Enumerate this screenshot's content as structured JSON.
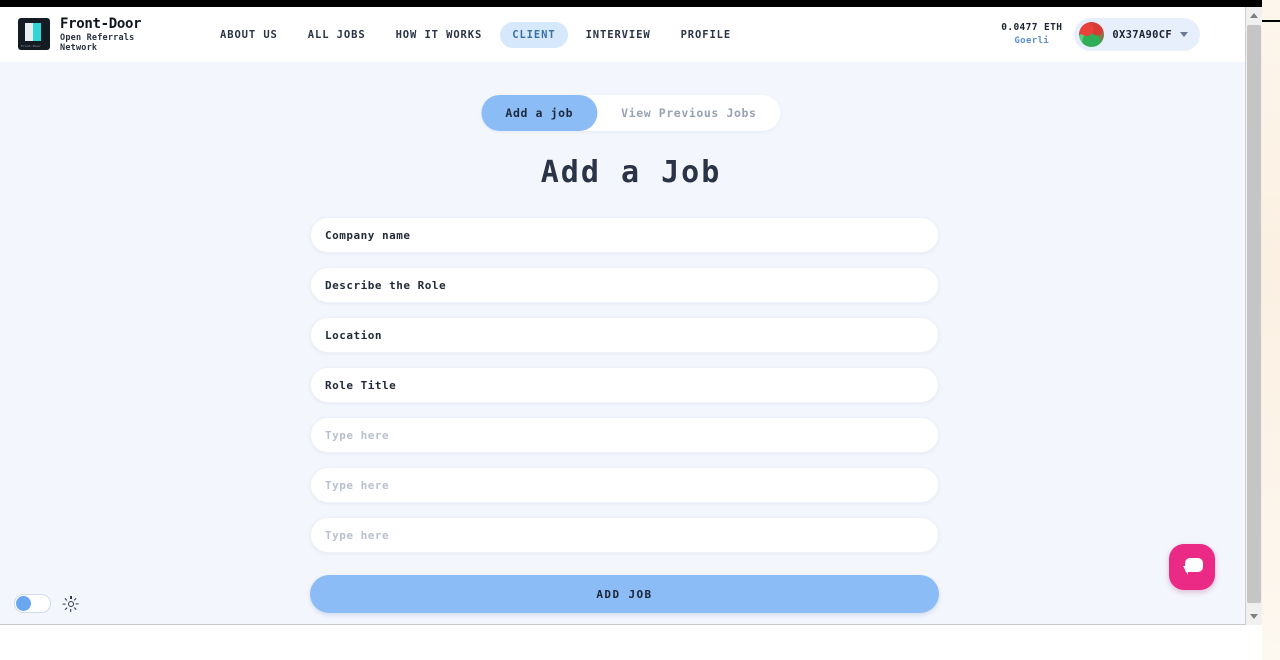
{
  "brand": {
    "name": "Front-Door",
    "tagline": "Open Referrals Network",
    "logo_caption": "Front-Door",
    "logo_icon": "door-logo-icon"
  },
  "nav": {
    "items": [
      {
        "label": "ABOUT US",
        "active": false
      },
      {
        "label": "ALL JOBS",
        "active": false
      },
      {
        "label": "HOW IT WORKS",
        "active": false
      },
      {
        "label": "CLIENT",
        "active": true
      },
      {
        "label": "INTERVIEW",
        "active": false
      },
      {
        "label": "PROFILE",
        "active": false
      }
    ],
    "active_accent": "#d6e8fb"
  },
  "wallet": {
    "balance": "0.0477 ETH",
    "network": "Goerli",
    "address": "0X37A90CF",
    "avatar_icon": "blockies-avatar-icon",
    "chevron_icon": "chevron-down-icon",
    "network_color": "#5a8fd6",
    "pill_color": "#e6effb"
  },
  "tabs": [
    {
      "label": "Add a job",
      "active": true
    },
    {
      "label": "View Previous Jobs",
      "active": false
    }
  ],
  "page": {
    "title": "Add a Job",
    "background": "#f3f6fd"
  },
  "form": {
    "fields": [
      {
        "value": "Company name",
        "placeholder": "Company name",
        "filled": true
      },
      {
        "value": "Describe the Role",
        "placeholder": "Describe the Role",
        "filled": true
      },
      {
        "value": "Location",
        "placeholder": "Location",
        "filled": true
      },
      {
        "value": "Role Title",
        "placeholder": "Role Title",
        "filled": true
      },
      {
        "value": "",
        "placeholder": "Type here",
        "filled": false
      },
      {
        "value": "",
        "placeholder": "Type here",
        "filled": false
      },
      {
        "value": "",
        "placeholder": "Type here",
        "filled": false
      }
    ],
    "submit_label": "ADD JOB",
    "submit_color": "#8cbcf5"
  },
  "theme_toggle": {
    "state": "off",
    "toggle_icon": "theme-toggle-icon",
    "sun_icon": "sun-icon"
  },
  "chat": {
    "icon": "chat-bubble-icon",
    "color": "#ea2a84"
  },
  "scrollbar": {
    "up_icon": "scroll-up-arrow-icon",
    "down_icon": "scroll-down-arrow-icon"
  }
}
